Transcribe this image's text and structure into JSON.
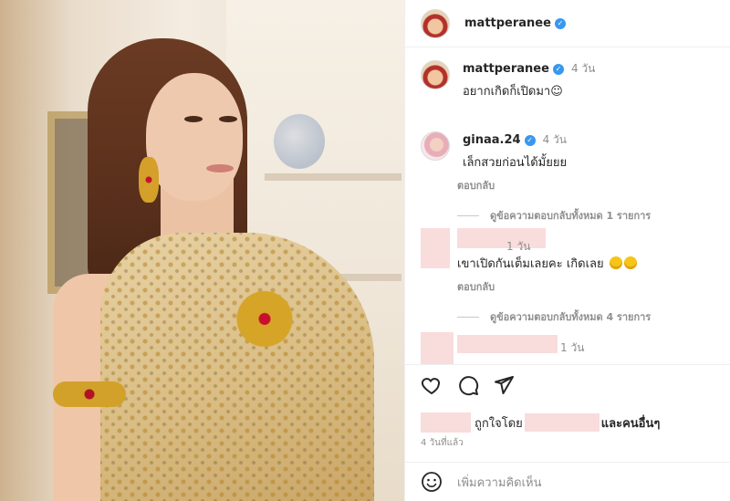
{
  "header": {
    "username": "mattperanee",
    "verified_glyph": "✓"
  },
  "caption": {
    "username": "mattperanee",
    "time": "4 วัน",
    "text": "อยากเกิดก็เปิดมา☺"
  },
  "comments": [
    {
      "username": "ginaa.24",
      "time": "4 วัน",
      "text": "เล็กสวยก่อนได้มั้ยยย",
      "reply_label": "ตอบกลับ",
      "view_replies": "ดูข้อความตอบกลับทั้งหมด 1 รายการ"
    },
    {
      "username": "",
      "time": "1 วัน",
      "text": "เขาเปิดกันเต็มเลยคะ เกิดเลย",
      "reply_label": "ตอบกลับ",
      "view_replies": "ดูข้อความตอบกลับทั้งหมด 4 รายการ"
    },
    {
      "username": "",
      "time": "1 วัน",
      "text": ""
    }
  ],
  "actions": {
    "liked_by_prefix": "ถูกใจโดย",
    "and_others": "และคนอื่นๆ",
    "posted_time": "4 วันที่แล้ว"
  },
  "add_comment": {
    "placeholder": "เพิ่มความคิดเห็น"
  },
  "colors": {
    "verified": "#3897f0",
    "muted": "#8e8e8e",
    "redaction": "#f9dcdc"
  },
  "icons": [
    "heart-icon",
    "comment-icon",
    "share-icon",
    "emoji-icon",
    "verified-badge-icon"
  ]
}
